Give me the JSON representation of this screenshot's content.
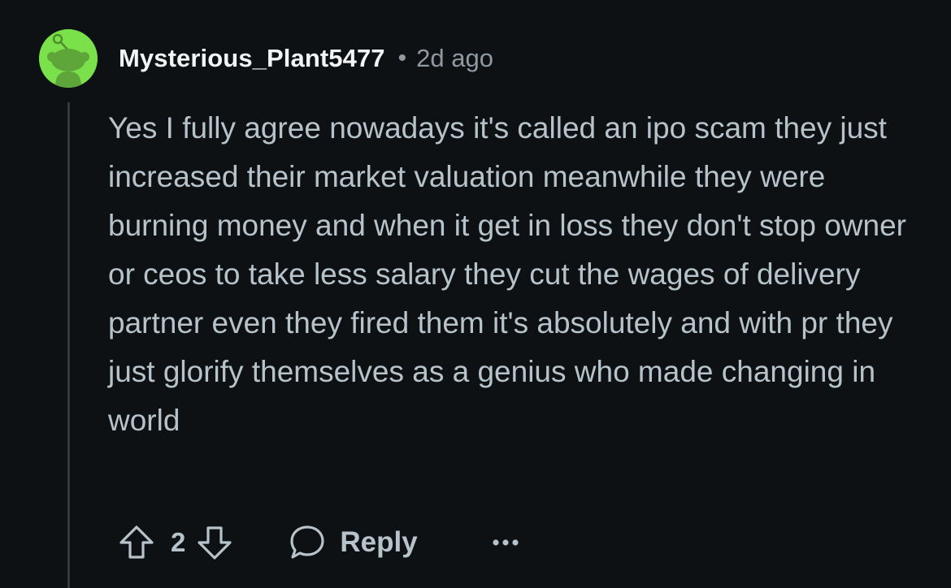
{
  "comment": {
    "author": "Mysterious_Plant5477",
    "separator": "•",
    "age": "2d ago",
    "avatar_icon": "snoo-avatar-icon",
    "avatar_color": "#7be14a",
    "text": "Yes I fully agree nowadays it's called an ipo scam they just increased their market valuation meanwhile they were burning money and when it get in loss they don't stop owner or ceos to take less salary they cut the wages of delivery partner even they fired them it's absolutely and with pr they just glorify themselves as a genius who made changing in world"
  },
  "actions": {
    "upvote_icon": "arrow-up-icon",
    "vote_count": "2",
    "downvote_icon": "arrow-down-icon",
    "reply_icon": "speech-bubble-icon",
    "reply_label": "Reply",
    "more_icon": "ellipsis-icon"
  }
}
